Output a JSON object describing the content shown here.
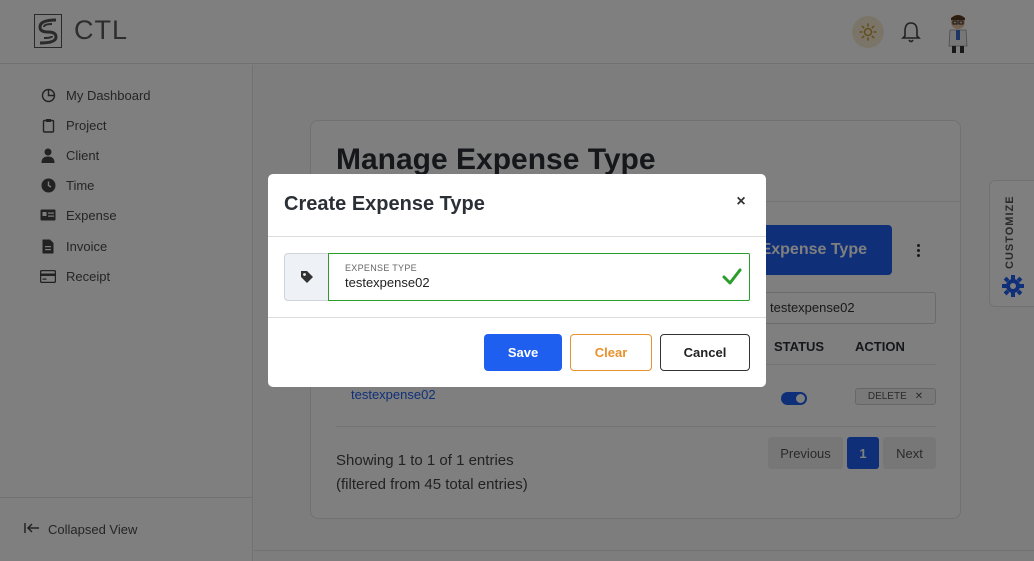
{
  "header": {
    "brand": "CTL",
    "icons": [
      "logo-icon",
      "sun-icon",
      "bell-icon",
      "avatar"
    ]
  },
  "sidebar": {
    "items": [
      {
        "label": "My Dashboard",
        "icon": "dashboard-icon"
      },
      {
        "label": "Project",
        "icon": "clipboard-icon"
      },
      {
        "label": "Client",
        "icon": "user-icon"
      },
      {
        "label": "Time",
        "icon": "clock-icon"
      },
      {
        "label": "Expense",
        "icon": "id-card-icon"
      },
      {
        "label": "Invoice",
        "icon": "invoice-icon"
      },
      {
        "label": "Receipt",
        "icon": "receipt-icon"
      }
    ],
    "collapse_label": "Collapsed View"
  },
  "page": {
    "title": "Manage Expense Type",
    "add_button_label": "Expense Type",
    "search_value": "testexpense02",
    "columns": {
      "status": "STATUS",
      "action": "ACTION"
    },
    "rows": [
      {
        "name": "testexpense02",
        "status_on": true,
        "action_label": "DELETE"
      }
    ],
    "info_line1": "Showing 1 to 1 of 1 entries",
    "info_line2": "(filtered from 45 total entries)",
    "pagination": {
      "previous": "Previous",
      "current": "1",
      "next": "Next"
    },
    "customize_label": "CUSTOMIZE"
  },
  "modal": {
    "title": "Create Expense Type",
    "close_symbol": "×",
    "field_label": "EXPENSE TYPE",
    "field_value": "testexpense02",
    "save_label": "Save",
    "clear_label": "Clear",
    "cancel_label": "Cancel"
  },
  "colors": {
    "primary": "#1f5ff0",
    "valid": "#2a9d2a",
    "clear": "#e8912d",
    "overlay": "rgba(0,0,0,0.5)"
  }
}
